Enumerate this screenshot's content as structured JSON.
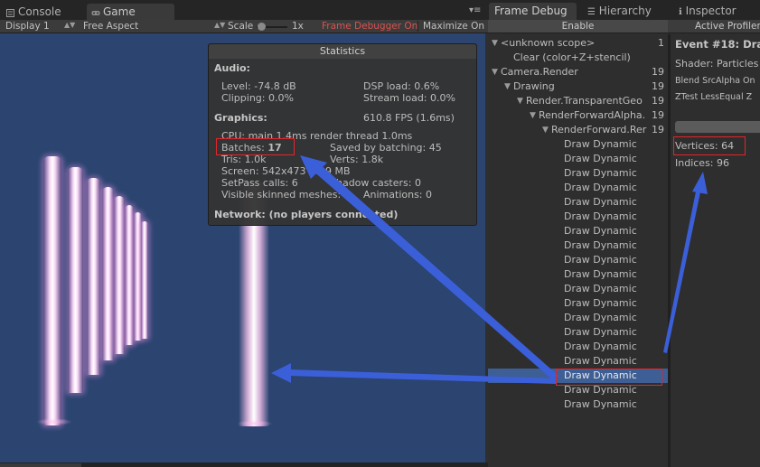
{
  "left_tabs": [
    {
      "label": "Console",
      "icon": "console-icon"
    },
    {
      "label": "Game",
      "icon": "game-controller-icon"
    }
  ],
  "left_tab_menu": "▾≡",
  "toolbar": {
    "display": "Display 1",
    "aspect": "Free Aspect",
    "scale_label": "Scale",
    "scale_value": "1x",
    "frame_debugger": "Frame Debugger On",
    "maximize": "Maximize On"
  },
  "stats": {
    "title": "Statistics",
    "audio_header": "Audio:",
    "level": "Level: -74.8 dB",
    "clipping": "Clipping: 0.0%",
    "dsp_load": "DSP load: 0.6%",
    "stream_load": "Stream load: 0.0%",
    "graphics_header": "Graphics:",
    "fps": "610.8 FPS (1.6ms)",
    "cpu": "CPU: main 1.4ms  render thread 1.0ms",
    "batches_label": "Batches: ",
    "batches_value": "17",
    "saved_batching": "Saved by batching: 45",
    "tris": "Tris: 1.0k",
    "verts": "Verts: 1.8k",
    "screen": "Screen: 542x473 - 2.9 MB",
    "shadow_casters": "Shadow casters: 0",
    "setpass": "SetPass calls: 6",
    "skinned_meshes": "Visible skinned meshes: 0",
    "animations": "Animations: 0",
    "network": "Network: (no players connected)"
  },
  "right_tabs": [
    {
      "label": "Frame Debug",
      "icon": ""
    },
    {
      "label": "Hierarchy",
      "icon": "hierarchy-icon"
    },
    {
      "label": "Inspector",
      "icon": "info-icon"
    }
  ],
  "enable_label": "Enable",
  "active_profiler": "Active Profiler",
  "tree": [
    {
      "label": "<unknown scope>",
      "count": "1",
      "indent": 0,
      "expanded": true
    },
    {
      "label": "Clear (color+Z+stencil)",
      "count": "",
      "indent": 1,
      "expanded": null
    },
    {
      "label": "Camera.Render",
      "count": "19",
      "indent": 0,
      "expanded": true
    },
    {
      "label": "Drawing",
      "count": "19",
      "indent": 1,
      "expanded": true
    },
    {
      "label": "Render.TransparentGeo",
      "count": "19",
      "indent": 2,
      "expanded": true
    },
    {
      "label": "RenderForwardAlpha.",
      "count": "19",
      "indent": 3,
      "expanded": true
    },
    {
      "label": "RenderForward.Rer",
      "count": "19",
      "indent": 4,
      "expanded": true
    },
    {
      "label": "Draw Dynamic",
      "count": "",
      "indent": 5,
      "expanded": null
    },
    {
      "label": "Draw Dynamic",
      "count": "",
      "indent": 5,
      "expanded": null
    },
    {
      "label": "Draw Dynamic",
      "count": "",
      "indent": 5,
      "expanded": null
    },
    {
      "label": "Draw Dynamic",
      "count": "",
      "indent": 5,
      "expanded": null
    },
    {
      "label": "Draw Dynamic",
      "count": "",
      "indent": 5,
      "expanded": null
    },
    {
      "label": "Draw Dynamic",
      "count": "",
      "indent": 5,
      "expanded": null
    },
    {
      "label": "Draw Dynamic",
      "count": "",
      "indent": 5,
      "expanded": null
    },
    {
      "label": "Draw Dynamic",
      "count": "",
      "indent": 5,
      "expanded": null
    },
    {
      "label": "Draw Dynamic",
      "count": "",
      "indent": 5,
      "expanded": null
    },
    {
      "label": "Draw Dynamic",
      "count": "",
      "indent": 5,
      "expanded": null
    },
    {
      "label": "Draw Dynamic",
      "count": "",
      "indent": 5,
      "expanded": null
    },
    {
      "label": "Draw Dynamic",
      "count": "",
      "indent": 5,
      "expanded": null
    },
    {
      "label": "Draw Dynamic",
      "count": "",
      "indent": 5,
      "expanded": null
    },
    {
      "label": "Draw Dynamic",
      "count": "",
      "indent": 5,
      "expanded": null
    },
    {
      "label": "Draw Dynamic",
      "count": "",
      "indent": 5,
      "expanded": null
    },
    {
      "label": "Draw Dynamic",
      "count": "",
      "indent": 5,
      "expanded": null
    },
    {
      "label": "Draw Dynamic",
      "count": "",
      "indent": 5,
      "expanded": null,
      "selected": true
    },
    {
      "label": "Draw Dynamic",
      "count": "",
      "indent": 5,
      "expanded": null
    },
    {
      "label": "Draw Dynamic",
      "count": "",
      "indent": 5,
      "expanded": null
    }
  ],
  "detail": {
    "event": "Event #18: Dra",
    "shader": "Shader: Particles",
    "blend": "Blend SrcAlpha On",
    "ztest": "ZTest LessEqual Z",
    "vertices": "Vertices: 64",
    "indices": "Indices: 96"
  },
  "colors": {
    "highlight_box": "#e0262a",
    "arrow": "#3b5fd8",
    "selection": "#3e5f95",
    "viewport_bg": "#2b4470",
    "frame_debugger_text": "#d9534f"
  }
}
